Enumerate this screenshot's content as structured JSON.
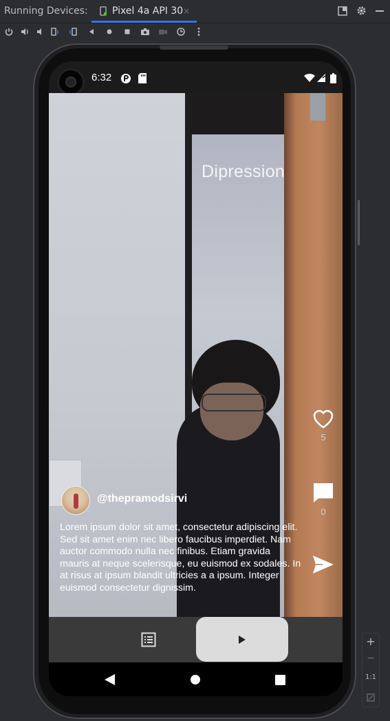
{
  "ide": {
    "panel_title": "Running Devices:",
    "device_tab": "Pixel 4a API 30",
    "tab_close": "×",
    "toolbar_icons": [
      "power-icon",
      "volume-up-icon",
      "volume-down-icon",
      "rotate-left-icon",
      "rotate-right-icon",
      "back-icon",
      "home-icon",
      "overview-icon",
      "screenshot-icon",
      "screen-record-icon",
      "snapshot-icon",
      "more-icon"
    ],
    "zoom": {
      "plus": "+",
      "minus": "−",
      "actual": "1:1"
    }
  },
  "status_bar": {
    "time": "6:32"
  },
  "video": {
    "title": "Dipression"
  },
  "post": {
    "username": "@thepramodsirvi",
    "caption": "Lorem ipsum dolor sit amet, consectetur adipiscing elit. Sed sit amet enim nec libero faucibus imperdiet. Nam auctor commodo nulla nec finibus. Etiam gravida mauris at neque scelerisque, eu euismod ex sodales. In at risus at ipsum blandit ultricies a a ipsum. Integer euismod consectetur dignissim.",
    "likes": "5",
    "comments": "0"
  },
  "colors": {
    "ide_bg": "#2b2d30",
    "tab_underline": "#3574f0",
    "bottom_bar": "#3a3a3a",
    "play_button": "#dcdcdc"
  }
}
